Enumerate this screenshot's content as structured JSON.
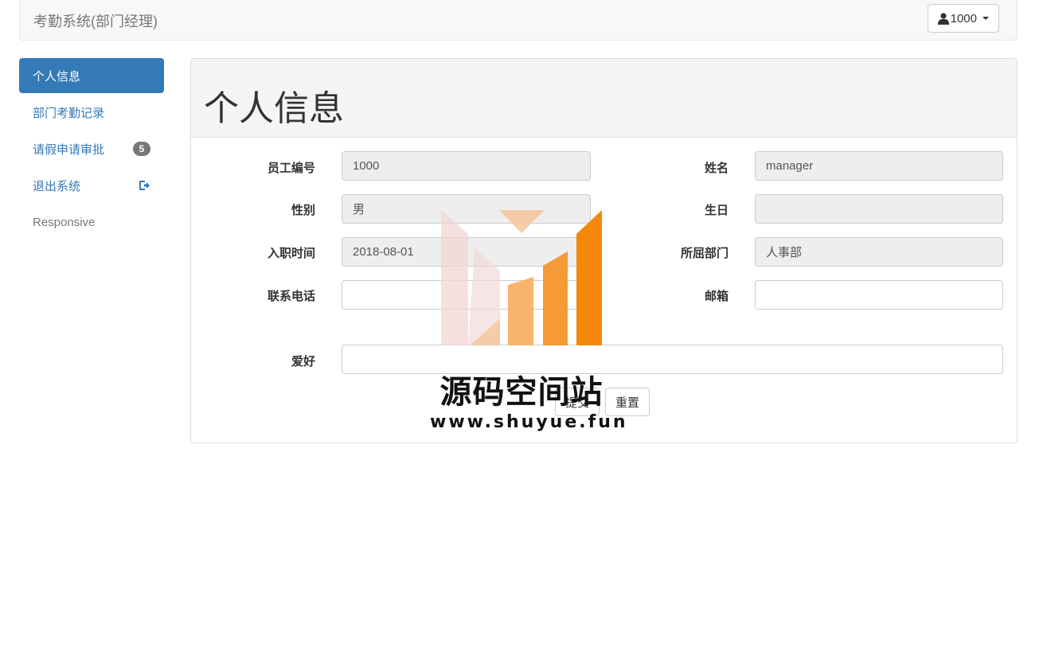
{
  "navbar": {
    "brand": "考勤系统(部门经理)",
    "user_label": "1000"
  },
  "sidebar": {
    "items": [
      {
        "label": "个人信息",
        "active": true
      },
      {
        "label": "部门考勤记录"
      },
      {
        "label": "请假申请审批",
        "badge": "5"
      },
      {
        "label": "退出系统"
      },
      {
        "label": "Responsive"
      }
    ]
  },
  "panel": {
    "title": "个人信息"
  },
  "form": {
    "emp_id_label": "员工编号",
    "emp_id_value": "1000",
    "name_label": "姓名",
    "name_value": "manager",
    "gender_label": "性别",
    "gender_value": "男",
    "birthday_label": "生日",
    "birthday_value": "",
    "hire_date_label": "入职时间",
    "hire_date_value": "2018-08-01",
    "department_label": "所屈部门",
    "department_value": "人事部",
    "phone_label": "联系电话",
    "phone_value": "",
    "email_label": "邮箱",
    "email_value": "",
    "hobby_label": "爱好",
    "hobby_value": "",
    "submit_label": "提交",
    "reset_label": "重置"
  },
  "watermark": {
    "title": "源码空间站",
    "url": "www.shuyue.fun"
  },
  "colors": {
    "primary": "#337ab7",
    "badge": "#777777",
    "watermark_orange": "#f5870a"
  }
}
